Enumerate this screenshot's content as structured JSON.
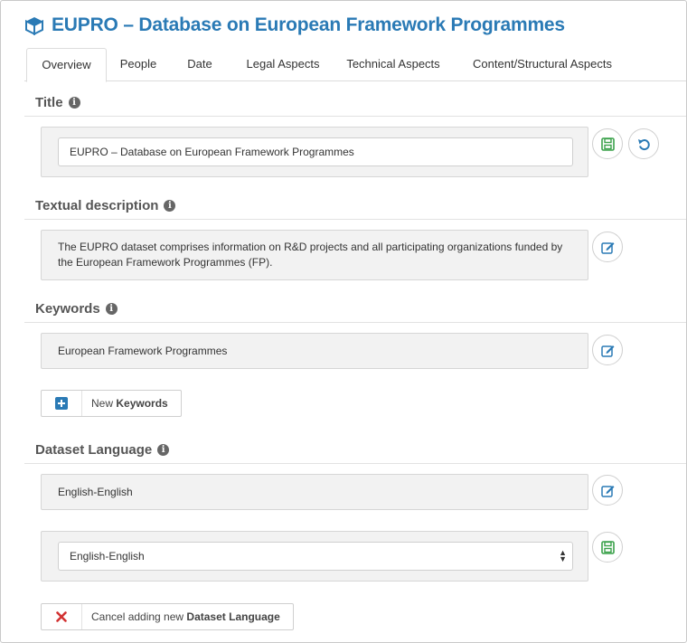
{
  "header": {
    "title": "EUPRO – Database on European Framework Programmes",
    "icon": "cube-icon"
  },
  "tabs": [
    "Overview",
    "People",
    "Date",
    "Legal Aspects",
    "Technical Aspects",
    "Content/Structural Aspects"
  ],
  "title_section": {
    "heading": "Title",
    "value": "EUPRO – Database on European Framework Programmes"
  },
  "description_section": {
    "heading": "Textual description",
    "line1": "The EUPRO dataset comprises information on R&D projects and all participating organizations funded by",
    "line2": "the European Framework Programmes (FP)."
  },
  "keywords_section": {
    "heading": "Keywords",
    "value": "European Framework Programmes",
    "new_prefix": "New",
    "new_bold": "Keywords"
  },
  "language_section": {
    "heading": "Dataset Language",
    "value": "English-English",
    "select_value": "English-English",
    "cancel_prefix": "Cancel adding new",
    "cancel_bold": "Dataset Language"
  },
  "colors": {
    "accent": "#2a7ab5",
    "save_green": "#3aa14a",
    "cancel_red": "#d23232",
    "panel_bg": "#f2f2f2"
  }
}
